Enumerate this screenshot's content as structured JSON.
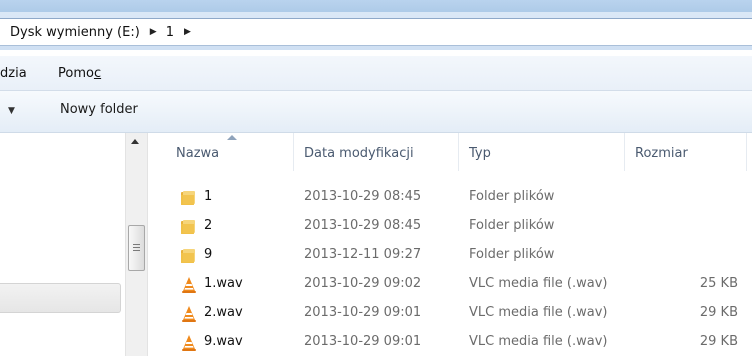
{
  "address": {
    "drive": "Dysk wymienny (E:)",
    "folder": "1"
  },
  "menu": {
    "tools_partial": "dzia",
    "help": "Pomo",
    "help_underline": "c"
  },
  "toolbar": {
    "new_folder": "Nowy folder"
  },
  "columns": {
    "name": "Nazwa",
    "date": "Data modyfikacji",
    "type": "Typ",
    "size": "Rozmiar"
  },
  "files": [
    {
      "name": "1",
      "date": "2013-10-29 08:45",
      "type": "Folder plików",
      "size": "",
      "icon": "folder-icon"
    },
    {
      "name": "2",
      "date": "2013-10-29 08:45",
      "type": "Folder plików",
      "size": "",
      "icon": "folder-icon"
    },
    {
      "name": "9",
      "date": "2013-12-11 09:27",
      "type": "Folder plików",
      "size": "",
      "icon": "folder-icon"
    },
    {
      "name": "1.wav",
      "date": "2013-10-29 09:02",
      "type": "VLC media file (.wav)",
      "size": "25 KB",
      "icon": "vlc-icon"
    },
    {
      "name": "2.wav",
      "date": "2013-10-29 09:01",
      "type": "VLC media file (.wav)",
      "size": "29 KB",
      "icon": "vlc-icon"
    },
    {
      "name": "9.wav",
      "date": "2013-10-29 09:01",
      "type": "VLC media file (.wav)",
      "size": "29 KB",
      "icon": "vlc-icon"
    }
  ],
  "colors": {
    "accent": "#dbe8f6",
    "folder": "#f2c24a",
    "vlc": "#f08a1c"
  }
}
